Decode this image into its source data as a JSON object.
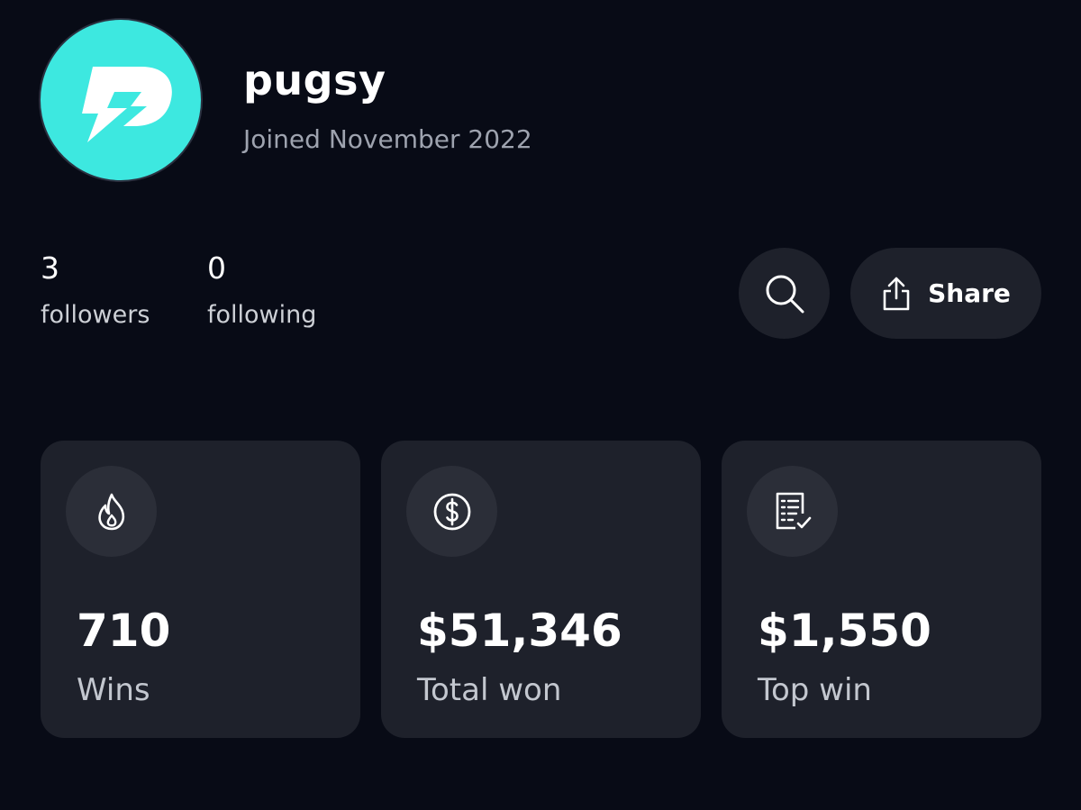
{
  "profile": {
    "username": "pugsy",
    "joined": "Joined November 2022",
    "avatar_color": "#3de8e0",
    "avatar_icon": "brand-logo-p"
  },
  "social": {
    "followers_count": "3",
    "followers_label": "followers",
    "following_count": "0",
    "following_label": "following"
  },
  "actions": {
    "search_icon": "search-icon",
    "share_label": "Share",
    "share_icon": "share-icon"
  },
  "stats": [
    {
      "icon": "flame-icon",
      "value": "710",
      "label": "Wins"
    },
    {
      "icon": "dollar-circle-icon",
      "value": "$51,346",
      "label": "Total won"
    },
    {
      "icon": "checklist-icon",
      "value": "$1,550",
      "label": "Top win"
    }
  ],
  "colors": {
    "background": "#080b16",
    "card": "#1e212b",
    "icon_circle": "#2b2e38",
    "muted_text": "#9ea3af"
  }
}
